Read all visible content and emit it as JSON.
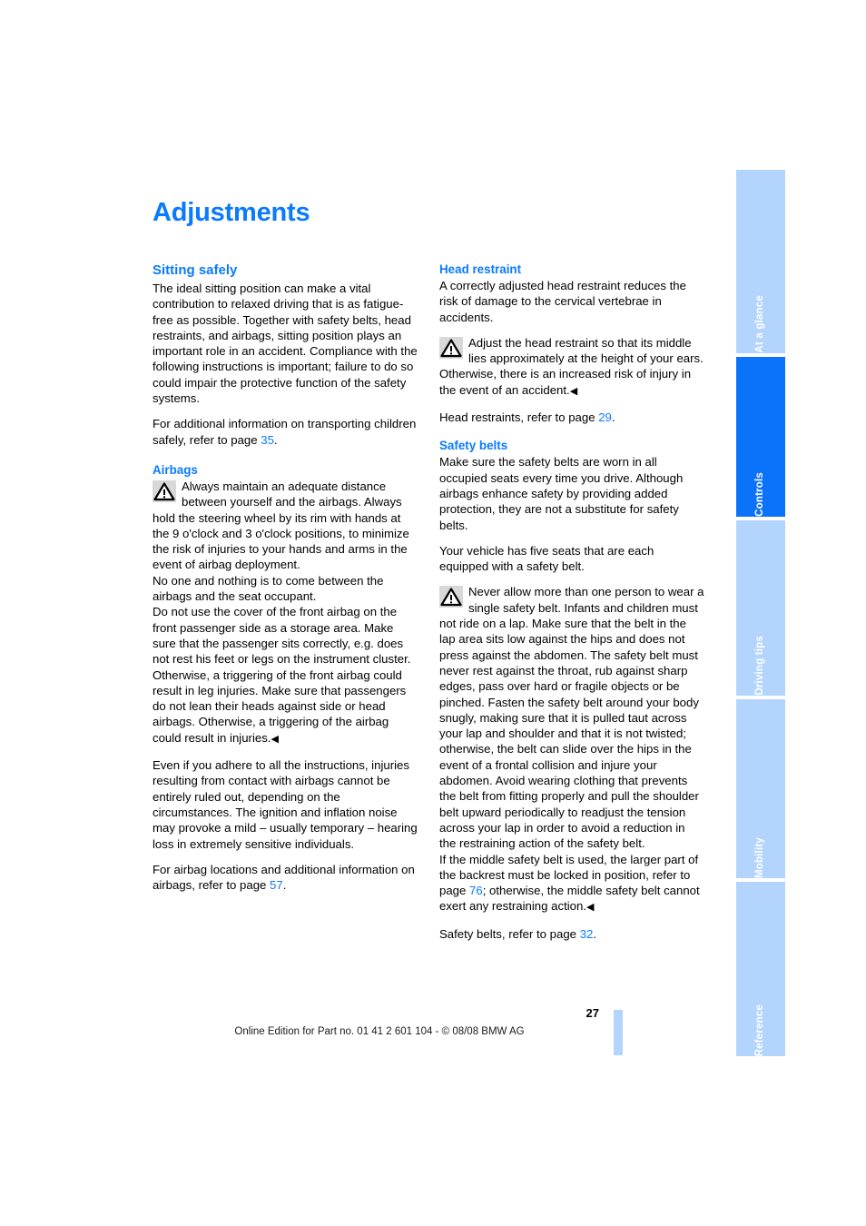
{
  "document": {
    "chapter_title": "Adjustments",
    "page_number": "27",
    "footer_note": "Online Edition for Part no. 01 41 2 601 104 - © 08/08 BMW AG"
  },
  "colors": {
    "heading_blue": "#0a7aff",
    "tab_active_blue": "#0a73fa",
    "tab_inactive_blue": "#b3d4fd",
    "warning_icon_background": "#d8d8d8"
  },
  "tabs": [
    {
      "label": "At a glance",
      "active": false
    },
    {
      "label": "Controls",
      "active": true
    },
    {
      "label": "Driving tips",
      "active": false
    },
    {
      "label": "Mobility",
      "active": false
    },
    {
      "label": "Reference",
      "active": false
    }
  ],
  "left_column": {
    "section_heading": "Sitting safely",
    "intro_paragraph": "The ideal sitting position can make a vital contribution to relaxed driving that is as fatigue-free as possible. Together with safety belts, head restraints, and airbags, sitting position plays an important role in an accident. Compliance with the following instructions is important; failure to do so could impair the protective function of the safety systems.",
    "children_ref_before": "For additional information on transporting children safely, refer to page ",
    "children_ref_page": "35",
    "children_ref_after": ".",
    "airbags_heading": "Airbags",
    "airbags_warning_1": "Always maintain an adequate distance between yourself and the airbags. Always hold the steering wheel by its rim with hands at the 9 o'clock and 3 o'clock positions, to minimize the risk of injuries to your hands and arms in the event of airbag deployment.",
    "airbags_warning_2": "No one and nothing is to come between the airbags and the seat occupant.",
    "airbags_warning_3": "Do not use the cover of the front airbag on the front passenger side as a storage area. Make sure that the passenger sits correctly, e.g. does not rest his feet or legs on the instrument cluster. Otherwise, a triggering of the front airbag could result in leg injuries. Make sure that passengers do not lean their heads against side or head airbags. Otherwise, a triggering of the airbag could result in injuries.",
    "airbags_paragraph": "Even if you adhere to all the instructions, injuries resulting from contact with airbags cannot be entirely ruled out, depending on the circumstances. The ignition and inflation noise may provoke a mild – usually temporary – hearing loss in extremely sensitive individuals.",
    "airbags_ref_before": "For airbag locations and additional information on airbags, refer to page ",
    "airbags_ref_page": "57",
    "airbags_ref_after": "."
  },
  "right_column": {
    "head_restraint_heading": "Head restraint",
    "head_restraint_paragraph": "A correctly adjusted head restraint reduces the risk of damage to the cervical vertebrae in accidents.",
    "head_restraint_warning": "Adjust the head restraint so that its middle lies approximately at the height of your ears. Otherwise, there is an increased risk of injury in the event of an accident.",
    "head_restraint_ref_before": "Head restraints, refer to page ",
    "head_restraint_ref_page": "29",
    "head_restraint_ref_after": ".",
    "safety_belts_heading": "Safety belts",
    "safety_belts_paragraph_1": "Make sure the safety belts are worn in all occupied seats every time you drive. Although airbags enhance safety by providing added protection, they are not a substitute for safety belts.",
    "safety_belts_paragraph_2": "Your vehicle has five seats that are each equipped with a safety belt.",
    "safety_belts_warning_1": "Never allow more than one person to wear a single safety belt. Infants and children must not ride on a lap. Make sure that the belt in the lap area sits low against the hips and does not press against the abdomen. The safety belt must never rest against the throat, rub against sharp edges, pass over hard or fragile objects or be pinched. Fasten the safety belt around your body snugly, making sure that it is pulled taut across your lap and shoulder and that it is not twisted; otherwise, the belt can slide over the hips in the event of a frontal collision and injure your abdomen. Avoid wearing clothing that prevents the belt from fitting properly and pull the shoulder belt upward periodically to readjust the tension across your lap in order to avoid a reduction in the restraining action of the safety belt.",
    "safety_belts_warning_2_before": "If the middle safety belt is used, the larger part of the backrest must be locked in position, refer to page ",
    "safety_belts_warning_2_page": "76",
    "safety_belts_warning_2_after": "; otherwise, the middle safety belt cannot exert any restraining action.",
    "safety_belts_ref_before": "Safety belts, refer to page ",
    "safety_belts_ref_page": "32",
    "safety_belts_ref_after": "."
  },
  "icons": {
    "warning_triangle": "warning-triangle-icon",
    "end_of_warning_marker": "◀"
  }
}
